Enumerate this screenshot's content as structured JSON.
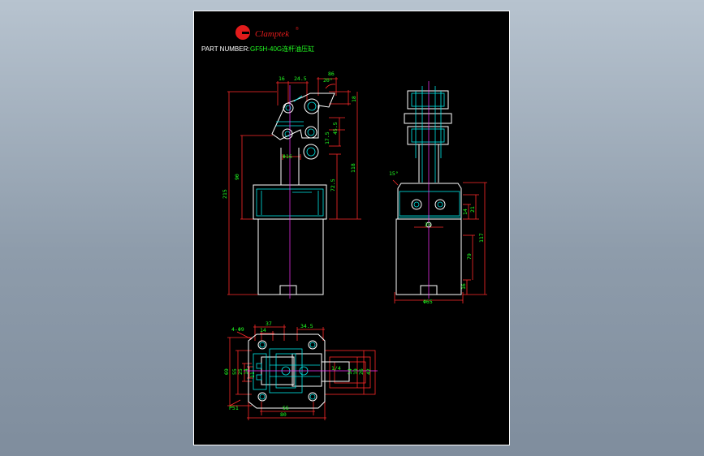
{
  "header": {
    "logo_text": "Clamptek",
    "logo_registered": "®",
    "part_number_label": "PART NUMBER:",
    "part_number_value": "GF5H-40G连杆油压缸"
  },
  "front_view": {
    "dim_16": "16",
    "dim_24_5": "24.5",
    "dim_86": "86",
    "dim_20deg": "20°",
    "dim_18": "18",
    "dim_45_5": "45.5",
    "dim_17_5": "17.5",
    "dim_phi16": "Φ16",
    "dim_90": "90",
    "dim_215": "215",
    "dim_118": "118",
    "dim_72_5": "72.5"
  },
  "side_view": {
    "dim_15deg": "15°",
    "dim_25": "25",
    "dim_14": "14",
    "dim_21": "21",
    "dim_117": "117",
    "dim_79": "79",
    "dim_16": "16",
    "dim_phi65": "Φ65"
  },
  "top_view": {
    "dim_37": "37",
    "dim_14": "14",
    "dim_34_5": "34.5",
    "dim_4phi9": "4-Φ9",
    "dim_69": "69",
    "dim_55": "55",
    "dim_25": "25",
    "dim_14b": "14",
    "dim_11": "11",
    "dim_1_4": "1/4",
    "dim_14c": "14",
    "dim_19": "19",
    "dim_26": "26",
    "dim_42": "42",
    "dim_55b": "55",
    "dim_80": "80",
    "dim_p51": "P51"
  },
  "colors": {
    "dimension": "#ff2a2a",
    "outline": "#ffffff",
    "detail": "#00e6e6",
    "text_dim": "#22ff22",
    "center": "#ff33ff",
    "logo": "#e21b1b",
    "sheet": "#000000"
  }
}
